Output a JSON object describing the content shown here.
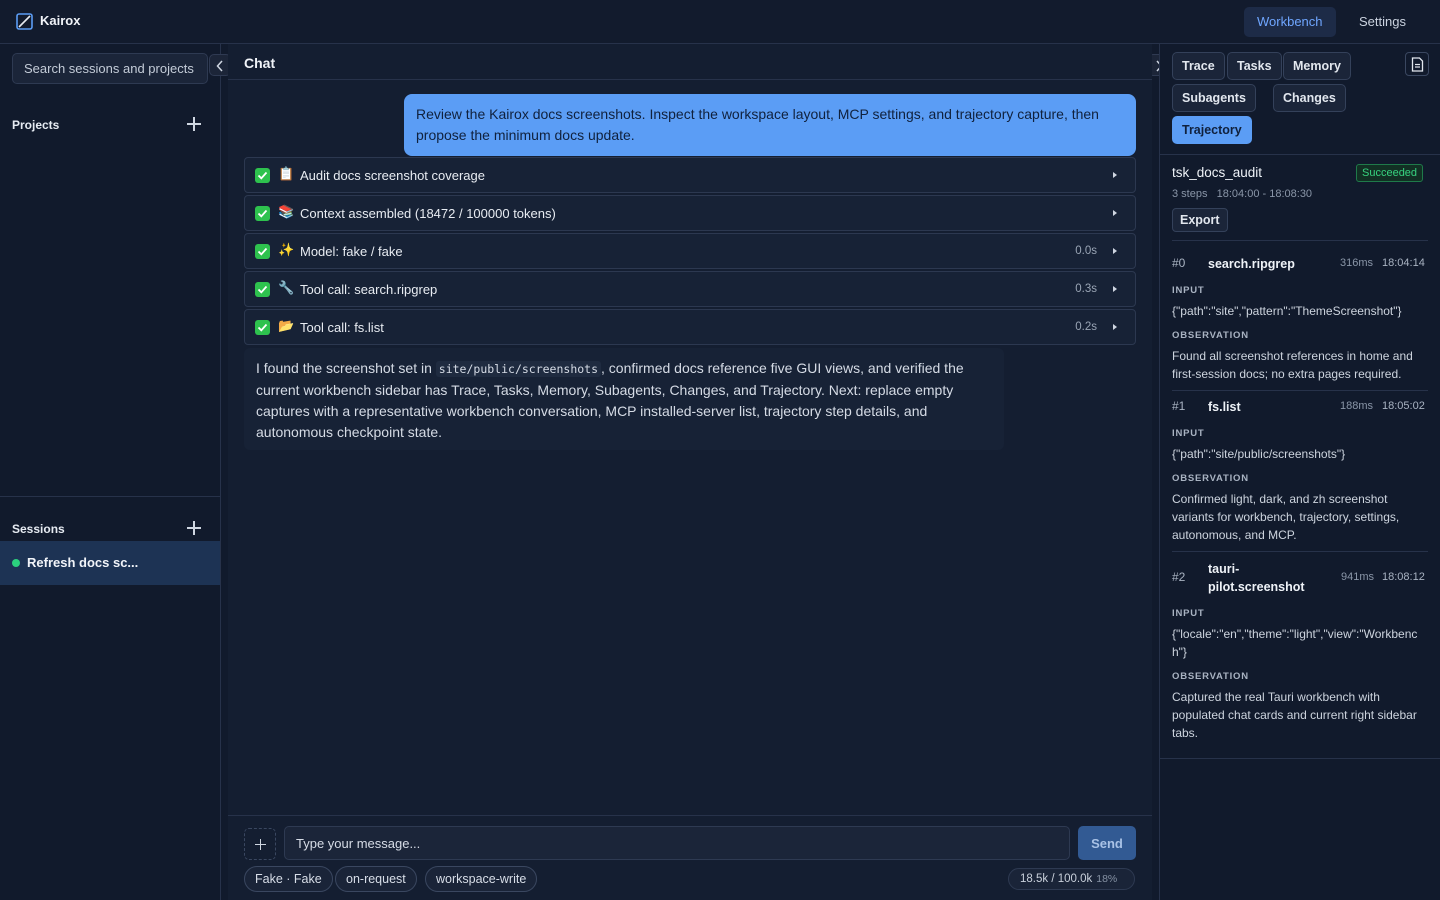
{
  "app": {
    "title": "Kairox"
  },
  "nav": {
    "workbench": "Workbench",
    "settings": "Settings"
  },
  "sidebar": {
    "search_placeholder": "Search sessions and projects",
    "projects_label": "Projects",
    "sessions_label": "Sessions",
    "sessions": [
      {
        "label": "Refresh docs sc...",
        "status": "active"
      }
    ]
  },
  "chat": {
    "title": "Chat",
    "user_message": "Review the Kairox docs screenshots. Inspect the workspace layout, MCP settings, and trajectory capture, then propose the minimum docs update.",
    "steps": [
      {
        "emoji": "📋",
        "label": "Audit docs screenshot coverage",
        "time": ""
      },
      {
        "emoji": "📚",
        "label": "Context assembled (18472 / 100000 tokens)",
        "time": ""
      },
      {
        "emoji": "✨",
        "label": "Model: fake / fake",
        "time": "0.0s"
      },
      {
        "emoji": "🔧",
        "label": "Tool call: search.ripgrep",
        "time": "0.3s"
      },
      {
        "emoji": "📂",
        "label": "Tool call: fs.list",
        "time": "0.2s"
      }
    ],
    "assistant": {
      "before": "I found the screenshot set in ",
      "code": "site/public/screenshots",
      "after": ", confirmed docs reference five GUI views, and verified the current workbench sidebar has Trace, Tasks, Memory, Subagents, Changes, and Trajectory. Next: replace empty captures with a representative workbench conversation, MCP installed-server list, trajectory step details, and autonomous checkpoint state."
    },
    "composer": {
      "placeholder": "Type your message...",
      "send_label": "Send",
      "chips": [
        "Fake · Fake",
        "on-request",
        "workspace-write"
      ],
      "usage": "18.5k / 100.0k",
      "usage_pct": "18%"
    }
  },
  "right_panel": {
    "tabs": [
      "Trace",
      "Tasks",
      "Memory",
      "Subagents",
      "Changes",
      "Trajectory"
    ],
    "active_tab": "Trajectory",
    "task": {
      "id": "tsk_docs_audit",
      "status": "Succeeded",
      "status_color": "#37d27f",
      "steps_count": "3 steps",
      "range": "18:04:00 - 18:08:30",
      "export_label": "Export"
    },
    "input_caption": "INPUT",
    "observation_caption": "OBSERVATION",
    "trajectory": [
      {
        "num": "#0",
        "name": "search.ripgrep",
        "duration": "316ms",
        "time": "18:04:14",
        "input": "{\"path\":\"site\",\"pattern\":\"ThemeScreenshot\"}",
        "observation": "Found all screenshot references in home and first-session docs; no extra pages required."
      },
      {
        "num": "#1",
        "name": "fs.list",
        "duration": "188ms",
        "time": "18:05:02",
        "input": "{\"path\":\"site/public/screenshots\"}",
        "observation": "Confirmed light, dark, and zh screenshot variants for workbench, trajectory, settings, autonomous, and MCP."
      },
      {
        "num": "#2",
        "name": "tauri-pilot.screenshot",
        "duration": "941ms",
        "time": "18:08:12",
        "input": "{\"locale\":\"en\",\"theme\":\"light\",\"view\":\"Workbench\"}",
        "observation": "Captured the real Tauri workbench with populated chat cards and current right sidebar tabs."
      }
    ]
  },
  "colors": {
    "accent": "#5b9df5",
    "success": "#2ec24e",
    "background": "#111a2c"
  }
}
